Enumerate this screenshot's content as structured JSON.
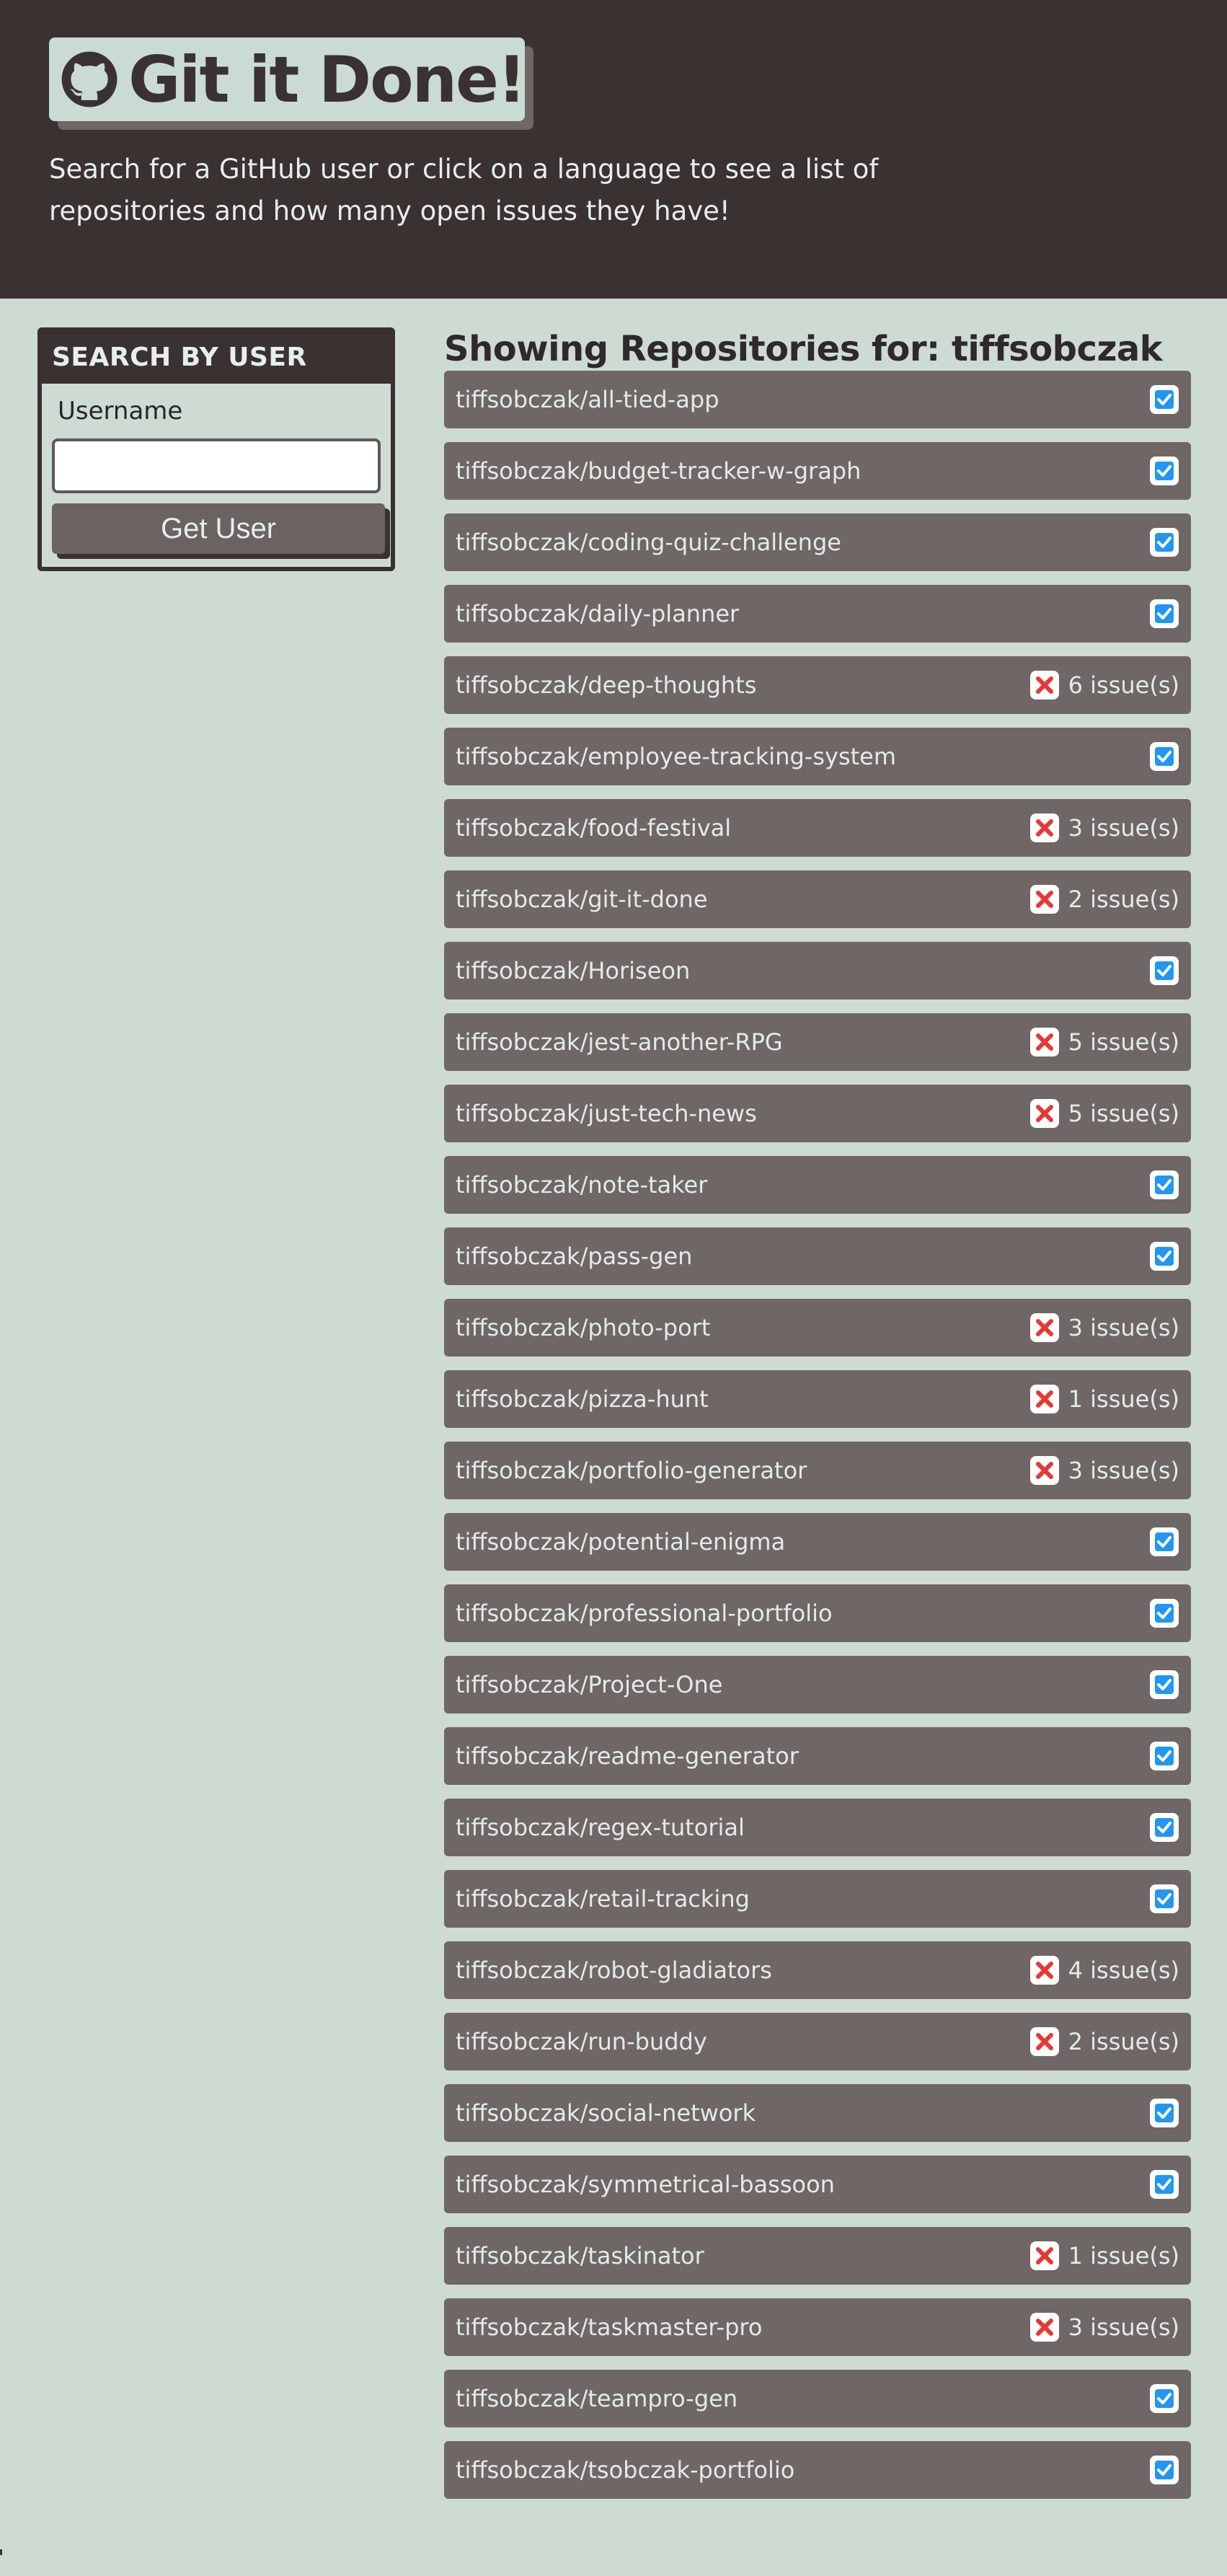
{
  "header": {
    "title": "Git it Done!",
    "icon": "github-icon",
    "description": "Search for a GitHub user or click on a language to see a list of repositories and how many open issues they have!"
  },
  "search": {
    "heading": "SEARCH BY USER",
    "label": "Username",
    "value": "",
    "placeholder": "",
    "button_label": "Get User"
  },
  "results": {
    "title": "Showing Repositories for: tiffsobczak",
    "repos": [
      {
        "name": "tiffsobczak/all-tied-app",
        "status": "check",
        "issues": ""
      },
      {
        "name": "tiffsobczak/budget-tracker-w-graph",
        "status": "check",
        "issues": ""
      },
      {
        "name": "tiffsobczak/coding-quiz-challenge",
        "status": "check",
        "issues": ""
      },
      {
        "name": "tiffsobczak/daily-planner",
        "status": "check",
        "issues": ""
      },
      {
        "name": "tiffsobczak/deep-thoughts",
        "status": "x",
        "issues": "6 issue(s)"
      },
      {
        "name": "tiffsobczak/employee-tracking-system",
        "status": "check",
        "issues": ""
      },
      {
        "name": "tiffsobczak/food-festival",
        "status": "x",
        "issues": "3 issue(s)"
      },
      {
        "name": "tiffsobczak/git-it-done",
        "status": "x",
        "issues": "2 issue(s)"
      },
      {
        "name": "tiffsobczak/Horiseon",
        "status": "check",
        "issues": ""
      },
      {
        "name": "tiffsobczak/jest-another-RPG",
        "status": "x",
        "issues": "5 issue(s)"
      },
      {
        "name": "tiffsobczak/just-tech-news",
        "status": "x",
        "issues": "5 issue(s)"
      },
      {
        "name": "tiffsobczak/note-taker",
        "status": "check",
        "issues": ""
      },
      {
        "name": "tiffsobczak/pass-gen",
        "status": "check",
        "issues": ""
      },
      {
        "name": "tiffsobczak/photo-port",
        "status": "x",
        "issues": "3 issue(s)"
      },
      {
        "name": "tiffsobczak/pizza-hunt",
        "status": "x",
        "issues": "1 issue(s)"
      },
      {
        "name": "tiffsobczak/portfolio-generator",
        "status": "x",
        "issues": "3 issue(s)"
      },
      {
        "name": "tiffsobczak/potential-enigma",
        "status": "check",
        "issues": ""
      },
      {
        "name": "tiffsobczak/professional-portfolio",
        "status": "check",
        "issues": ""
      },
      {
        "name": "tiffsobczak/Project-One",
        "status": "check",
        "issues": ""
      },
      {
        "name": "tiffsobczak/readme-generator",
        "status": "check",
        "issues": ""
      },
      {
        "name": "tiffsobczak/regex-tutorial",
        "status": "check",
        "issues": ""
      },
      {
        "name": "tiffsobczak/retail-tracking",
        "status": "check",
        "issues": ""
      },
      {
        "name": "tiffsobczak/robot-gladiators",
        "status": "x",
        "issues": "4 issue(s)"
      },
      {
        "name": "tiffsobczak/run-buddy",
        "status": "x",
        "issues": "2 issue(s)"
      },
      {
        "name": "tiffsobczak/social-network",
        "status": "check",
        "issues": ""
      },
      {
        "name": "tiffsobczak/symmetrical-bassoon",
        "status": "check",
        "issues": ""
      },
      {
        "name": "tiffsobczak/taskinator",
        "status": "x",
        "issues": "1 issue(s)"
      },
      {
        "name": "tiffsobczak/taskmaster-pro",
        "status": "x",
        "issues": "3 issue(s)"
      },
      {
        "name": "tiffsobczak/teampro-gen",
        "status": "check",
        "issues": ""
      },
      {
        "name": "tiffsobczak/tsobczak-portfolio",
        "status": "check",
        "issues": ""
      }
    ]
  },
  "colors": {
    "header_bg": "#3a3131",
    "page_bg": "#cddbd3",
    "repo_bg": "#6f6765",
    "check_blue": "#2196f3",
    "x_red": "#e53935"
  }
}
